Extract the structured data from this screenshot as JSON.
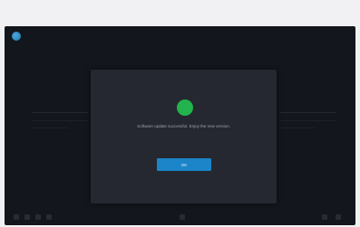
{
  "dialog": {
    "message": "Software update successful. Enjoy the new version.",
    "ok_label": "OK"
  },
  "colors": {
    "accent": "#1c84c8",
    "success": "#22b34e",
    "background": "#171a21",
    "dialog": "#252830"
  },
  "icons": {
    "brand": "app-logo-icon",
    "status": "success-icon"
  }
}
